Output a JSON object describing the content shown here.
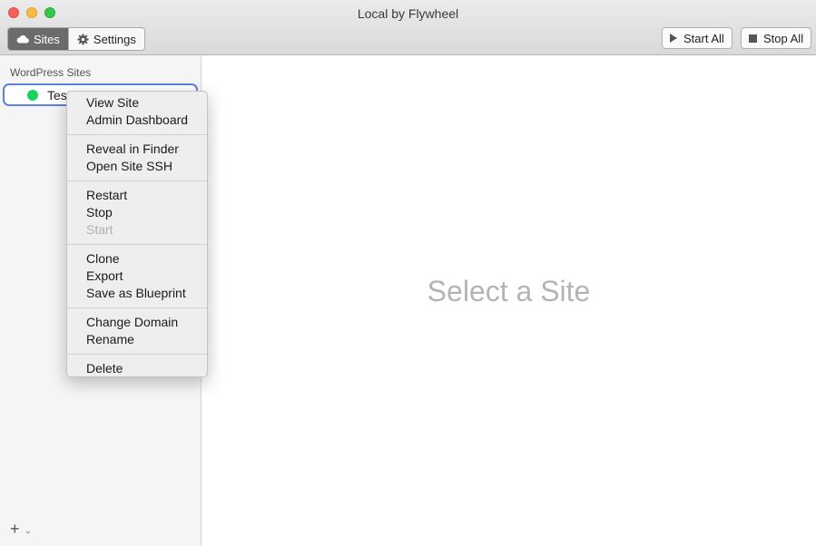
{
  "window": {
    "title": "Local by Flywheel"
  },
  "toolbar": {
    "sites_label": "Sites",
    "settings_label": "Settings",
    "start_all_label": "Start All",
    "stop_all_label": "Stop All"
  },
  "sidebar": {
    "heading": "WordPress Sites",
    "sites": [
      {
        "name": "Test",
        "status": "running",
        "status_color": "#1ad35b"
      }
    ],
    "add_label": "+"
  },
  "main": {
    "placeholder": "Select a Site"
  },
  "context_menu": {
    "groups": [
      [
        {
          "label": "View Site"
        },
        {
          "label": "Admin Dashboard"
        }
      ],
      [
        {
          "label": "Reveal in Finder"
        },
        {
          "label": "Open Site SSH"
        }
      ],
      [
        {
          "label": "Restart"
        },
        {
          "label": "Stop"
        },
        {
          "label": "Start",
          "disabled": true
        }
      ],
      [
        {
          "label": "Clone"
        },
        {
          "label": "Export"
        },
        {
          "label": "Save as Blueprint"
        }
      ],
      [
        {
          "label": "Change Domain"
        },
        {
          "label": "Rename"
        }
      ],
      [
        {
          "label": "Delete"
        }
      ]
    ]
  },
  "colors": {
    "accent_border": "#5b84d6",
    "status_green": "#1ad35b",
    "segment_active": "#6b6b6b"
  }
}
